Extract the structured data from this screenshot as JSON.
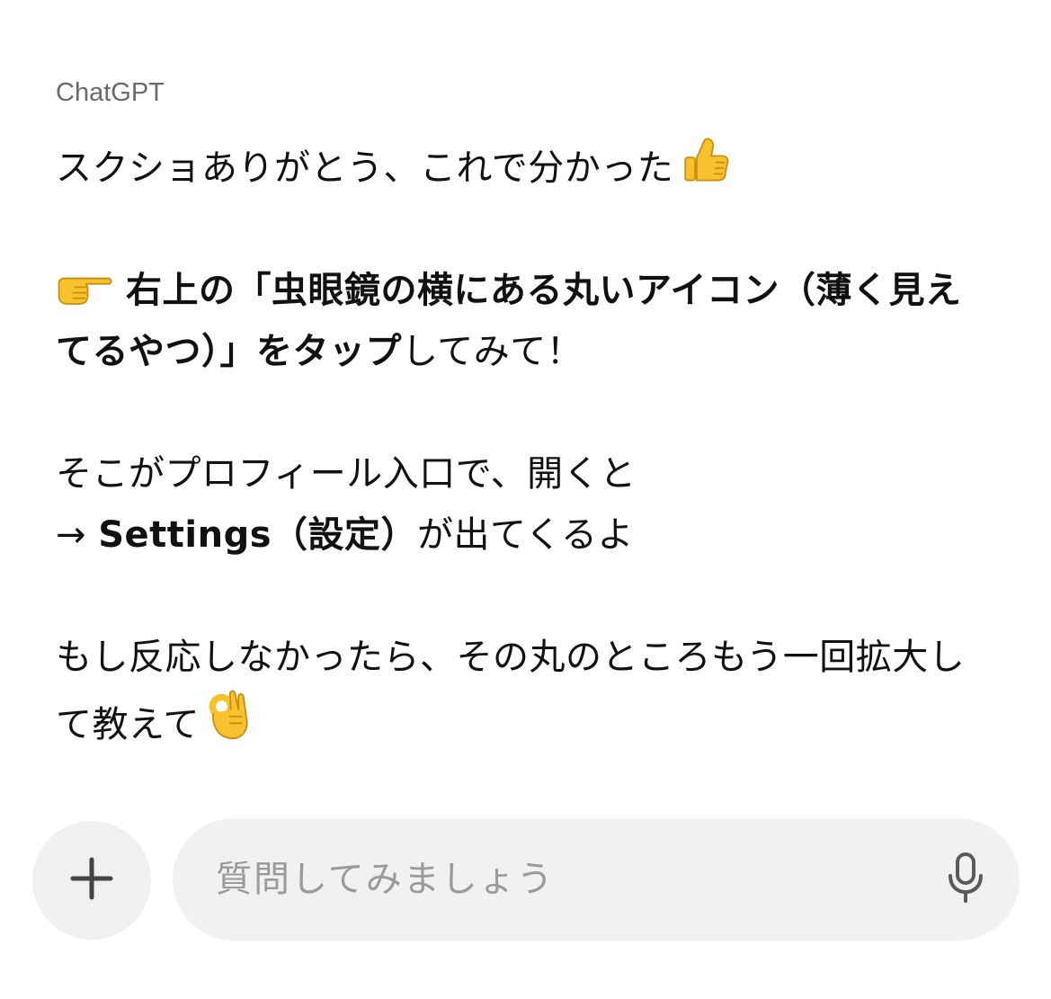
{
  "header": {
    "sender": "ChatGPT"
  },
  "message": {
    "line1": "スクショありがとう、これで分かった",
    "line1_emoji": "thumbs-up-icon",
    "line2_bold": "右上の「虫眼鏡の横にある丸いアイコン（薄く見えてるやつ）」をタップ",
    "line2_rest": "してみて！",
    "line2_emoji": "pointing-right-icon",
    "line3": "そこがプロフィール入口で、開くと",
    "line4_arrow": "→ ",
    "line4_bold": "Settings（設定）",
    "line4_rest": "が出てくるよ",
    "line5": "もし反応しなかったら、その丸のところもう一回拡大して教えて",
    "line5_emoji": "ok-hand-icon"
  },
  "composer": {
    "placeholder": "質問してみましょう",
    "value": "",
    "add_icon": "plus-icon",
    "mic_icon": "microphone-icon"
  },
  "colors": {
    "background": "#ffffff",
    "text": "#111111",
    "sender": "#6b6b6b",
    "composer_bg": "#f1f1f1",
    "placeholder": "#9a9a9a",
    "icon": "#5a5a5a",
    "emoji_yellow": "#f7c22e"
  }
}
